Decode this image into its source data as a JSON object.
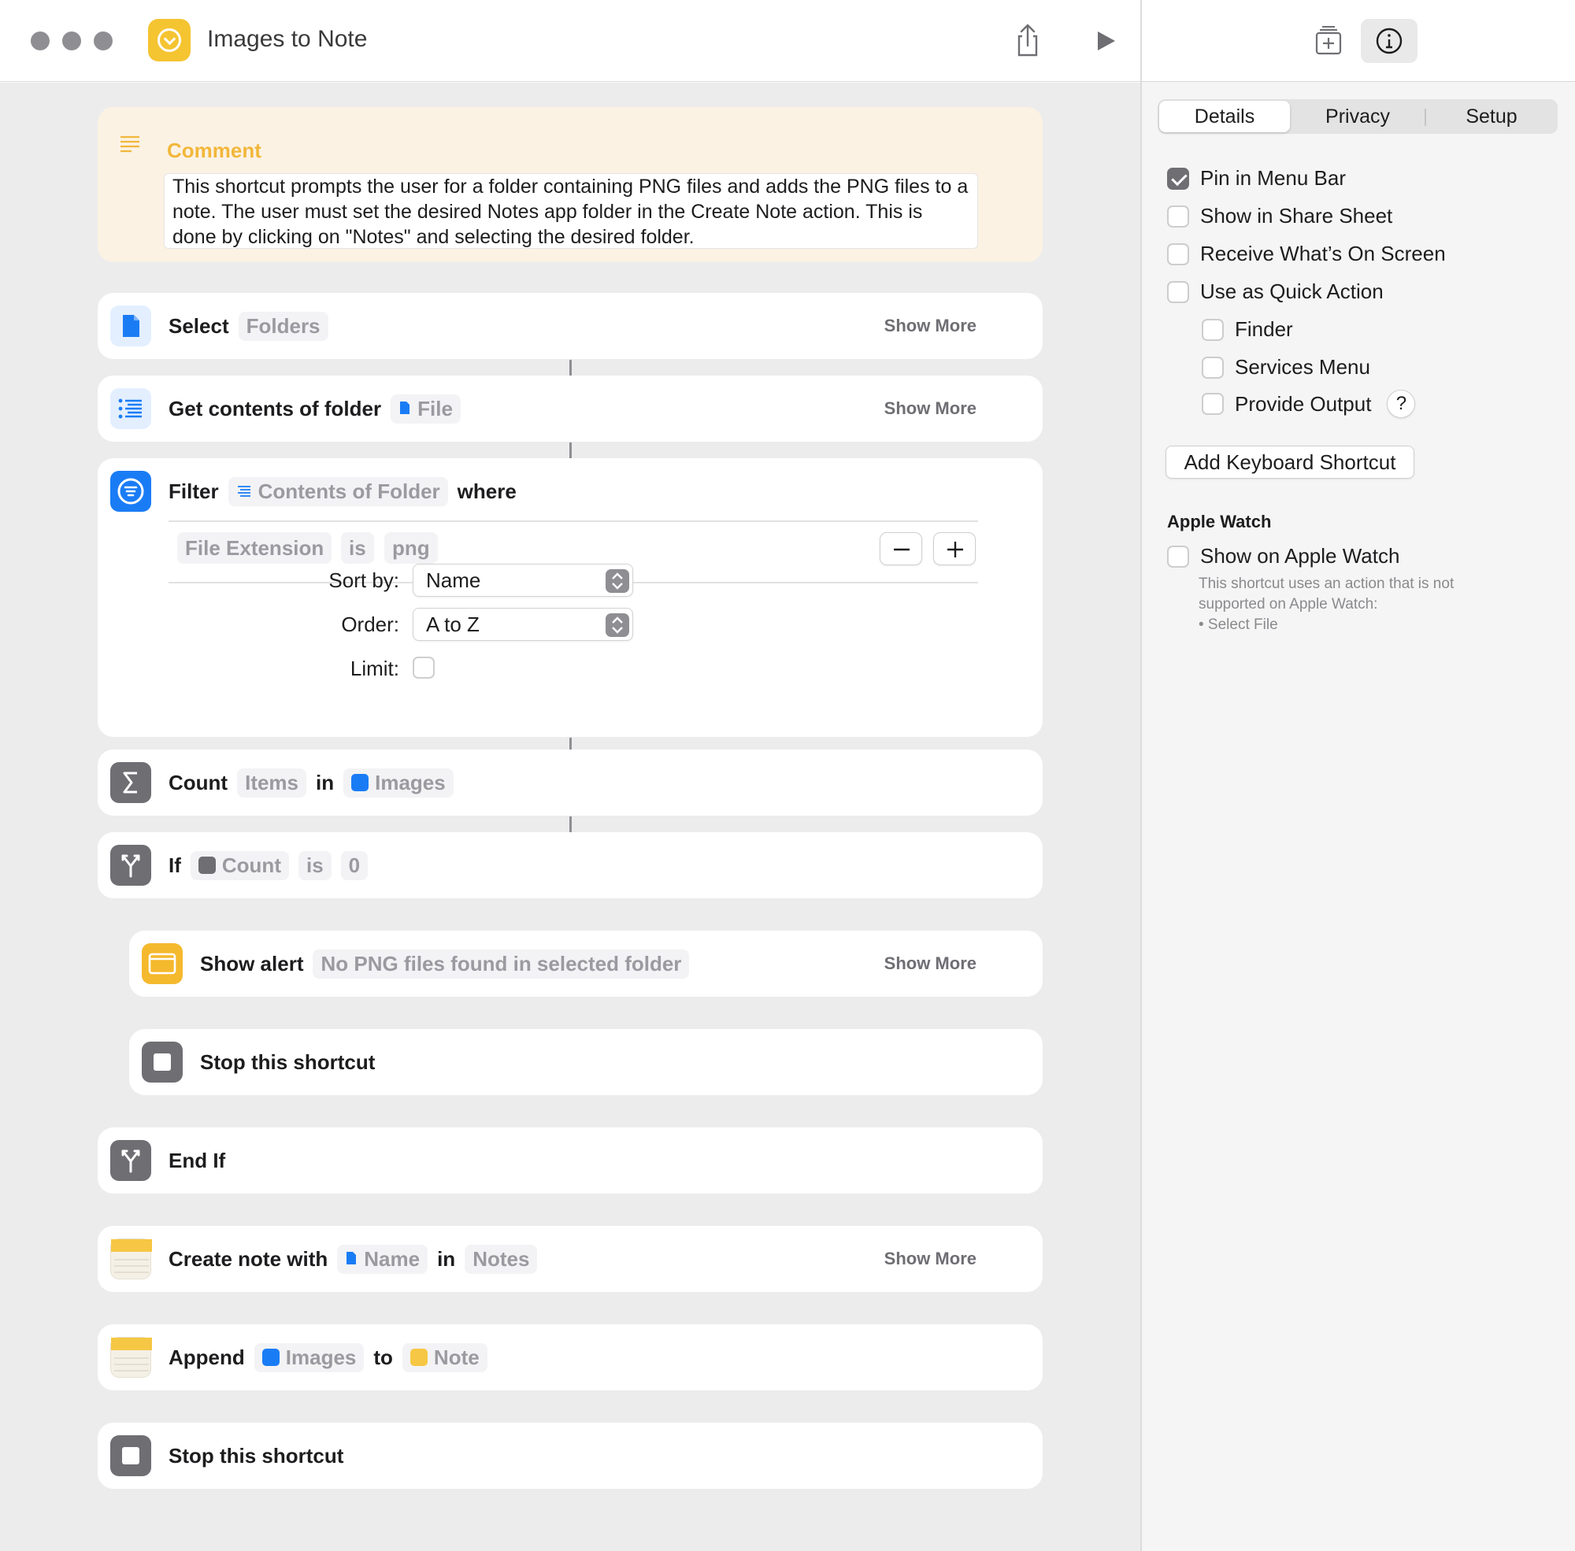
{
  "window": {
    "title": "Images to Note"
  },
  "actions": {
    "comment": {
      "title": "Comment",
      "text": "This shortcut prompts the user for a folder containing PNG files and adds the PNG files to a note. The user must set the desired Notes app folder in the Create Note action. This is done by clicking on \"Notes\" and selecting the desired folder."
    },
    "select": {
      "label": "Select",
      "token": "Folders",
      "show_more": "Show More"
    },
    "get_contents": {
      "label": "Get contents of folder",
      "token": "File",
      "show_more": "Show More"
    },
    "filter": {
      "label": "Filter",
      "token": "Contents of Folder",
      "where": "where",
      "condition": {
        "field": "File Extension",
        "op": "is",
        "value": "png"
      },
      "sort_label": "Sort by:",
      "sort_value": "Name",
      "order_label": "Order:",
      "order_value": "A to Z",
      "limit_label": "Limit:"
    },
    "count": {
      "label": "Count",
      "token1": "Items",
      "in": "in",
      "token2": "Images"
    },
    "if": {
      "label": "If",
      "token1": "Count",
      "op": "is",
      "value": "0"
    },
    "alert": {
      "label": "Show alert",
      "token": "No PNG files found in selected folder",
      "show_more": "Show More"
    },
    "stop1": {
      "label": "Stop this shortcut"
    },
    "endif": {
      "label": "End If"
    },
    "create_note": {
      "label": "Create note with",
      "token1": "Name",
      "in": "in",
      "token2": "Notes",
      "show_more": "Show More"
    },
    "append": {
      "label": "Append",
      "token1": "Images",
      "to": "to",
      "token2": "Note"
    },
    "stop2": {
      "label": "Stop this shortcut"
    }
  },
  "panel": {
    "tabs": [
      "Details",
      "Privacy",
      "Setup"
    ],
    "active_tab": "Details",
    "options": {
      "pin": {
        "label": "Pin in Menu Bar",
        "checked": true
      },
      "share": {
        "label": "Show in Share Sheet",
        "checked": false
      },
      "screen": {
        "label": "Receive What’s On Screen",
        "checked": false
      },
      "quick": {
        "label": "Use as Quick Action",
        "checked": false
      },
      "finder": {
        "label": "Finder",
        "checked": false
      },
      "services": {
        "label": "Services Menu",
        "checked": false
      },
      "output": {
        "label": "Provide Output",
        "checked": false,
        "help": "?"
      }
    },
    "keyboard_button": "Add Keyboard Shortcut",
    "watch_heading": "Apple Watch",
    "watch_option": {
      "label": "Show on Apple Watch",
      "checked": false
    },
    "watch_note": [
      "This shortcut uses an action that is not",
      "supported on Apple Watch:",
      "• Select File"
    ]
  },
  "colors": {
    "accent_blue": "#1a7cf5",
    "comment_yellow": "#f2b73a",
    "control_gray": "#8e8e93"
  }
}
